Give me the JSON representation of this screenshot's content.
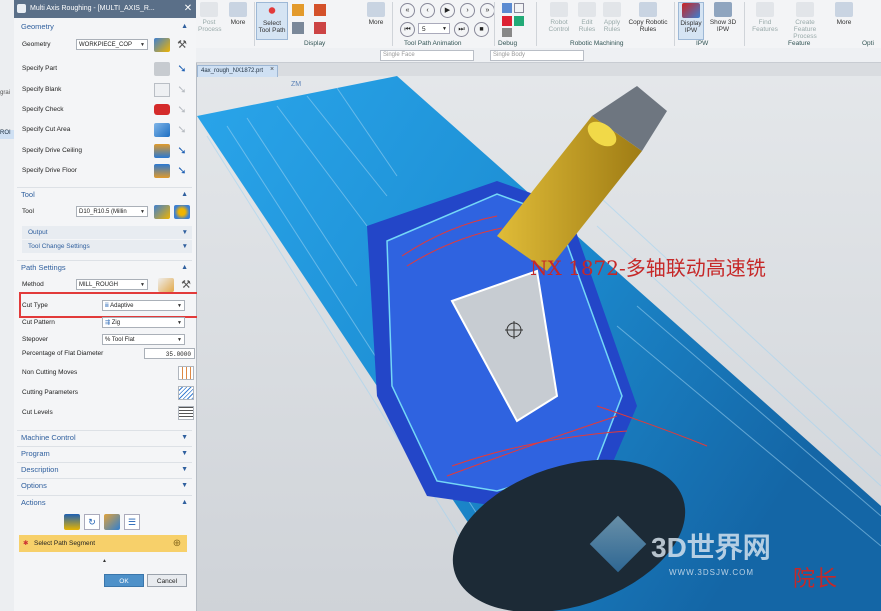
{
  "dialog": {
    "title": "Multi Axis Roughing - [MULTI_AXIS_R...",
    "geometry": {
      "header": "Geometry",
      "geometry_label": "Geometry",
      "geometry_value": "WORKPIECE_COP",
      "specify_part": "Specify Part",
      "specify_blank": "Specify Blank",
      "specify_check": "Specify Check",
      "specify_cut_area": "Specify Cut Area",
      "specify_drive_ceiling": "Specify Drive Ceiling",
      "specify_drive_floor": "Specify Drive Floor"
    },
    "tool": {
      "header": "Tool",
      "tool_label": "Tool",
      "tool_value": "D10_R10.5 (Millin",
      "output": "Output",
      "tool_change_settings": "Tool Change Settings"
    },
    "path_settings": {
      "header": "Path Settings",
      "method_label": "Method",
      "method_value": "MILL_ROUGH",
      "cut_type_label": "Cut Type",
      "cut_type_value": "Adaptive",
      "cut_pattern_label": "Cut Pattern",
      "cut_pattern_value": "Zig",
      "stepover_label": "Stepover",
      "stepover_value": "% Tool Flat",
      "pct_flat_label": "Percentage of Flat Diameter",
      "pct_flat_value": "35.0000",
      "non_cutting": "Non Cutting Moves",
      "cutting_params": "Cutting Parameters",
      "cut_levels": "Cut Levels"
    },
    "machine_control": "Machine Control",
    "program": "Program",
    "description": "Description",
    "options": "Options",
    "actions": {
      "header": "Actions",
      "select_path_segment": "Select Path Segment"
    },
    "ok": "OK",
    "cancel": "Cancel"
  },
  "ribbon": {
    "buttons": [
      "Post Process",
      "More",
      "Select Tool Path",
      "More",
      "Robot Control",
      "Edit Rules",
      "Apply Rules",
      "Copy Robotic Rules",
      "Display IPW",
      "Show 3D IPW",
      "Find Features",
      "Create Feature Process",
      "More"
    ],
    "groups": [
      "Display",
      "Tool Path Animation",
      "Debug",
      "Robotic Machining",
      "IPW",
      "Feature",
      "Opti"
    ],
    "speed_value": "5",
    "filter_1": "Single Face",
    "filter_2": "Single Body"
  },
  "tab": {
    "label": "4ax_rough_NX1872.prt"
  },
  "viewport": {
    "axis_label": "ZM",
    "caption": "NX 1872-多轴联动高速铣",
    "watermark_brand": "3D世界网",
    "watermark_url": "WWW.3DSJW.COM",
    "author": "院长"
  },
  "left_edge": {
    "label_1": "grai",
    "label_2": "ROI"
  },
  "colors": {
    "cylinder": "#1d8fd4",
    "caption": "#c62828",
    "highlight_box": "#e23a3a",
    "tool_holder": "#c8a21e"
  }
}
